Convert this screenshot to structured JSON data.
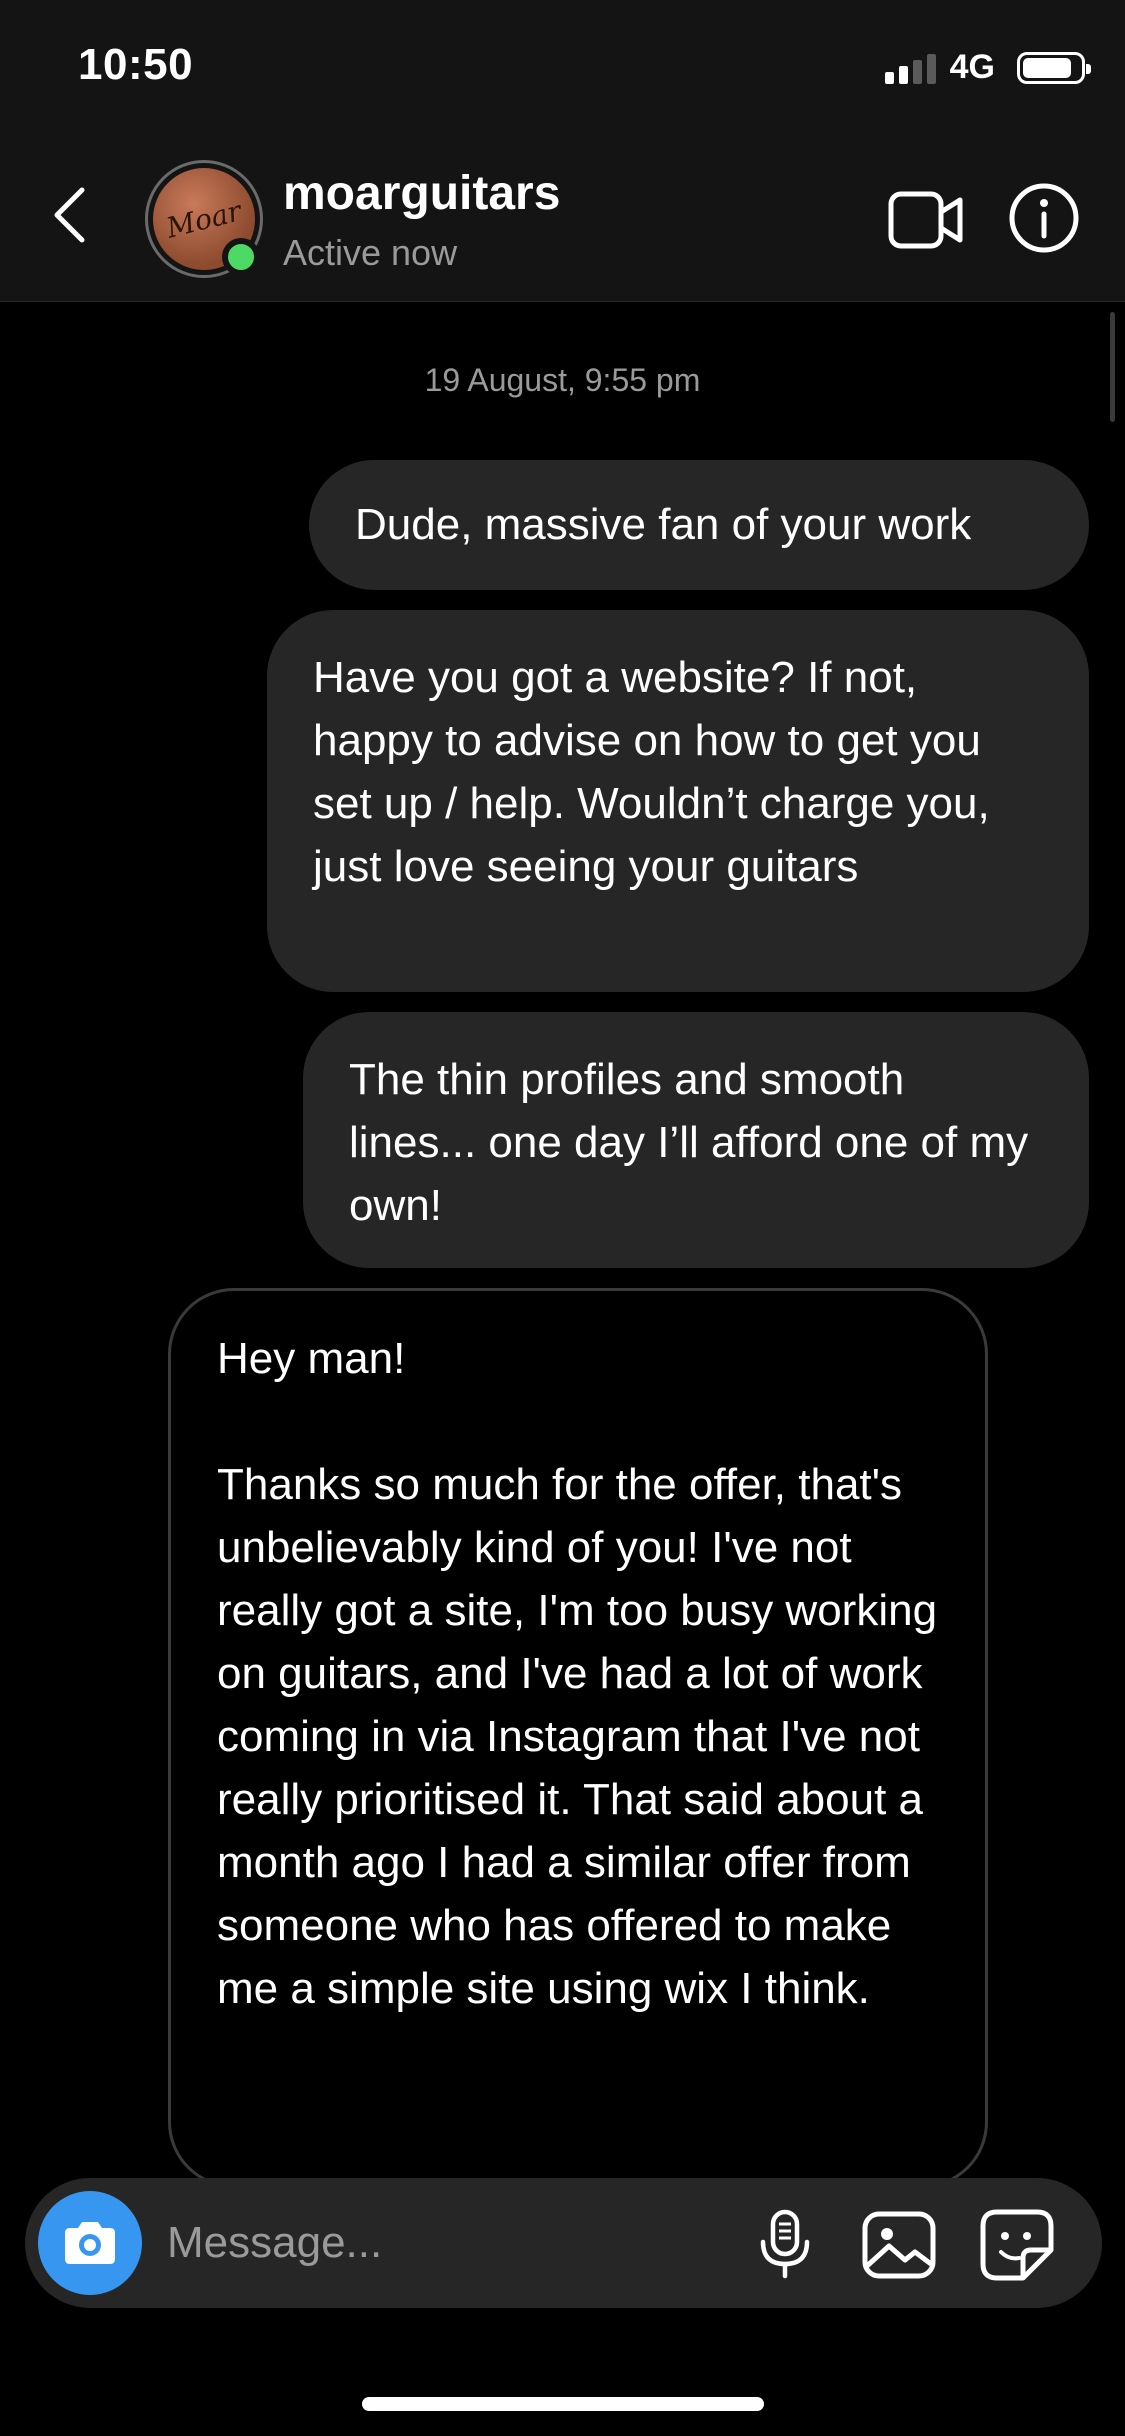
{
  "status_bar": {
    "time": "10:50",
    "network": "4G",
    "signal_bars": 2,
    "signal_total": 4,
    "battery_level": 0.8
  },
  "header": {
    "username": "moarguitars",
    "active_status": "Active now",
    "avatar_logo_text": "Moar",
    "online_color": "#4cd964"
  },
  "conversation": {
    "date_separator": "19 August, 9:55 pm",
    "messages": [
      {
        "from": "me",
        "text": "Dude, massive fan of your work"
      },
      {
        "from": "me",
        "text": "Have you got a website? If not, happy to advise on how to get you set up / help. Wouldn’t charge you, just love seeing your guitars"
      },
      {
        "from": "me",
        "text": "The thin profiles and smooth lines... one day I’ll afford one of my own!"
      },
      {
        "from": "them",
        "text": "Hey man!\n\nThanks so much for the offer, that's unbelievably kind of you! I've not really got a site, I'm too busy working on guitars, and I've had a lot of work coming in via Instagram that I've not really prioritised it. That said about a month ago I had a similar offer from someone who has offered to make me a simple site using wix I think."
      }
    ]
  },
  "composer": {
    "placeholder": "Message...",
    "value": "",
    "camera_color": "#3797f0"
  },
  "icons": [
    "back-chevron-icon",
    "video-call-icon",
    "info-icon",
    "camera-icon",
    "microphone-icon",
    "gallery-icon",
    "sticker-icon"
  ]
}
